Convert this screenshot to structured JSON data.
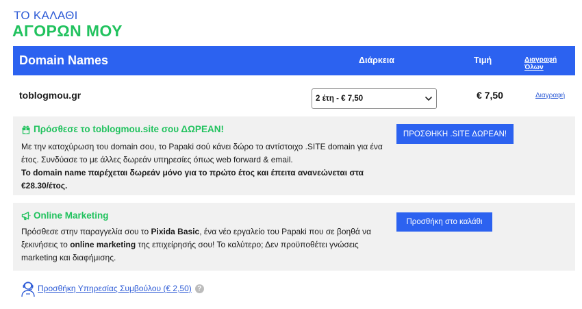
{
  "page": {
    "title_top": "ΤΟ ΚΑΛΑΘΙ",
    "title_main": "ΑΓΟΡΩΝ ΜΟΥ"
  },
  "table_header": {
    "domain_names": "Domain Names",
    "duration": "Διάρκεια",
    "price": "Τιμή",
    "delete_all": "Διαγραφή Όλων"
  },
  "cart_item": {
    "domain": "toblogmou.gr",
    "duration_selected": "2 έτη - € 7,50",
    "price": "€ 7,50",
    "delete": "Διαγραφή"
  },
  "promo_site": {
    "icon": "gift-icon",
    "title": "Πρόσθεσε το toblogmou.site σου ΔΩΡΕΑΝ!",
    "text_1": "Με την κατοχύρωση του domain σου, το Papaki σού κάνει δώρο το αντίστοιχο .SITE domain για ένα έτος. Συνδύασε το με άλλες δωρεάν υπηρεσίες όπως web forward & email.",
    "text_bold": "Το domain name παρέχεται δωρεάν μόνο για το πρώτο έτος και έπειτα ανανεώνεται στα €28.30/έτος.",
    "button": "ΠΡΟΣΘΗΚΗ .SITE ΔΩΡΕΑΝ!"
  },
  "promo_marketing": {
    "icon": "megaphone-icon",
    "title": "Online Marketing",
    "text_a": "Πρόσθεσε στην παραγγελία σου το ",
    "text_b": "Pixida Basic",
    "text_c": ", ένα νέο εργαλείο του Papaki που σε βοηθά να ξεκινήσεις το ",
    "text_d": "online marketing",
    "text_e": " της επιχείρησής σου! Το καλύτερο; Δεν προϋποθέτει γνώσεις marketing και διαφήμισης.",
    "button": "Προσθήκη στο καλάθι"
  },
  "consultant": {
    "icon": "support-agent-icon",
    "link": "Προσθήκη Υπηρεσίας Συμβούλου (€ 2,50)",
    "help": "?"
  },
  "colors": {
    "brand_blue": "#2c62f0",
    "accent_green": "#21c25e",
    "panel_gray": "#f1f1f1"
  }
}
